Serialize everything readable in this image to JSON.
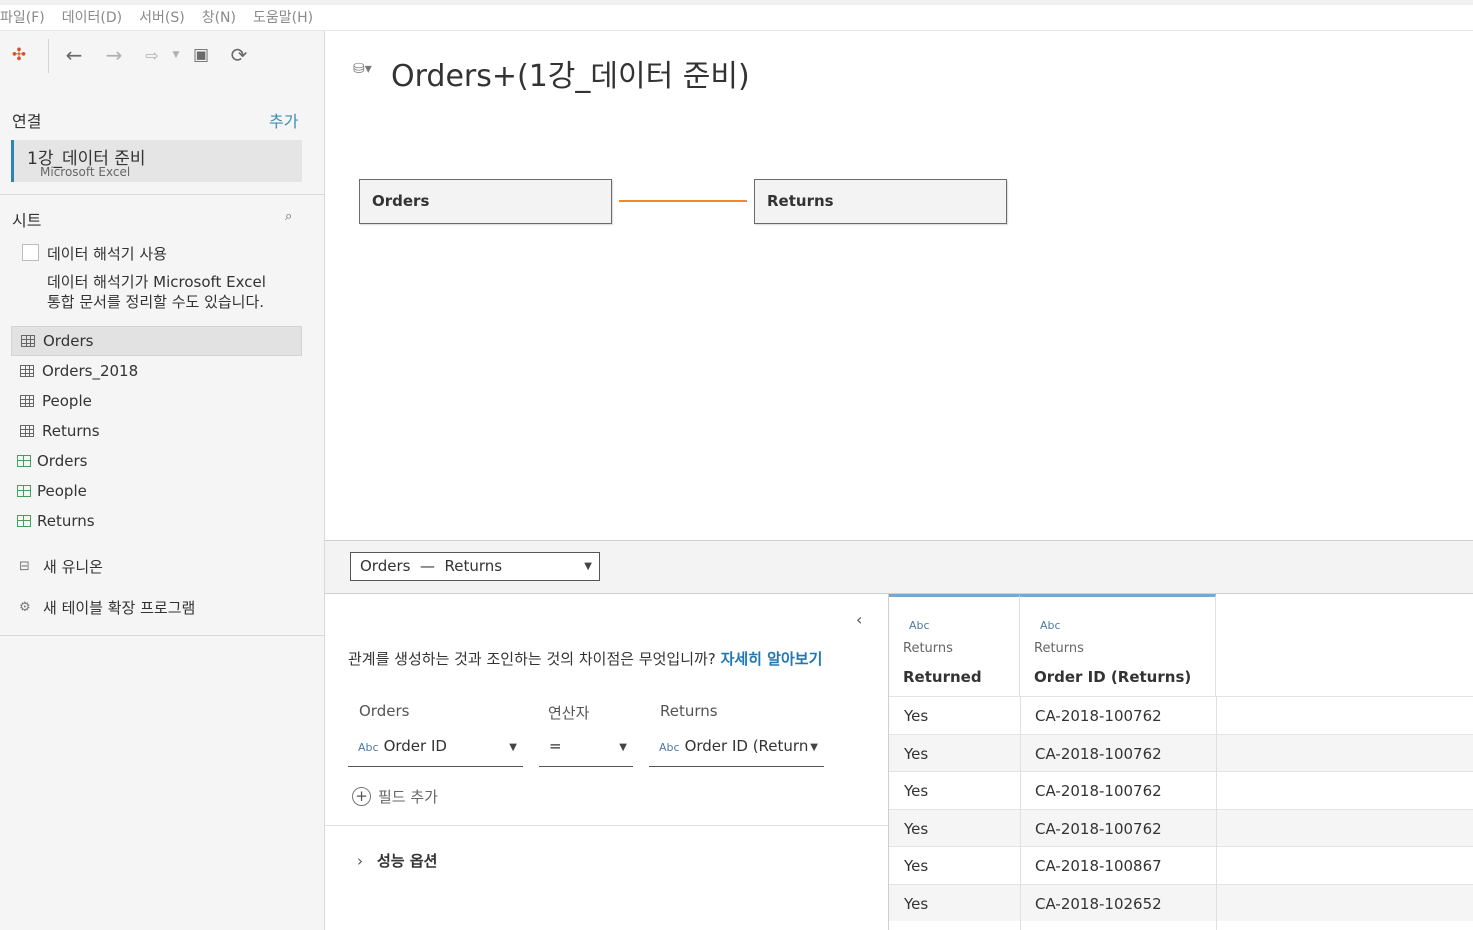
{
  "menu": [
    "파일(F)",
    "데이터(D)",
    "서버(S)",
    "창(N)",
    "도움말(H)"
  ],
  "connections": {
    "label": "연결",
    "add": "추가",
    "item_name": "1강_데이터 준비",
    "item_type": "Microsoft Excel"
  },
  "sheets": {
    "label": "시트",
    "interpreter_label": "데이터 해석기 사용",
    "interpreter_desc_1": "데이터 해석기가 Microsoft Excel",
    "interpreter_desc_2": "통합 문서를 정리할 수도 있습니다.",
    "items": [
      {
        "label": "Orders",
        "kind": "sheet"
      },
      {
        "label": "Orders_2018",
        "kind": "sheet"
      },
      {
        "label": "People",
        "kind": "sheet"
      },
      {
        "label": "Returns",
        "kind": "sheet"
      },
      {
        "label": "Orders",
        "kind": "named-range"
      },
      {
        "label": "People",
        "kind": "named-range"
      },
      {
        "label": "Returns",
        "kind": "named-range"
      }
    ],
    "new_union": "새 유니온",
    "new_extension": "새 테이블 확장 프로그램"
  },
  "canvas": {
    "title": "Orders+(1강_데이터 준비)",
    "left_table": "Orders",
    "right_table": "Returns"
  },
  "relationship": {
    "selector": "Orders  —  Returns",
    "help_text": "관계를 생성하는 것과 조인하는 것의 차이점은 무엇입니까?",
    "help_link": "자세히 알아보기",
    "col_left": "Orders",
    "col_op": "연산자",
    "col_right": "Returns",
    "left_field": "Order ID",
    "operator": "=",
    "right_field": "Order ID (Return",
    "abc": "Abc",
    "add_field": "필드 추가",
    "perf_options": "성능 옵션"
  },
  "grid": {
    "columns": [
      {
        "type": "Abc",
        "source": "Returns",
        "name": "Returned"
      },
      {
        "type": "Abc",
        "source": "Returns",
        "name": "Order ID (Returns)"
      }
    ],
    "rows": [
      [
        "Yes",
        "CA-2018-100762"
      ],
      [
        "Yes",
        "CA-2018-100762"
      ],
      [
        "Yes",
        "CA-2018-100762"
      ],
      [
        "Yes",
        "CA-2018-100762"
      ],
      [
        "Yes",
        "CA-2018-100867"
      ],
      [
        "Yes",
        "CA-2018-102652"
      ]
    ]
  },
  "colors": {
    "accent": "#3d8fb0",
    "noodle": "#ef8a2d",
    "link": "#1f77b4"
  }
}
